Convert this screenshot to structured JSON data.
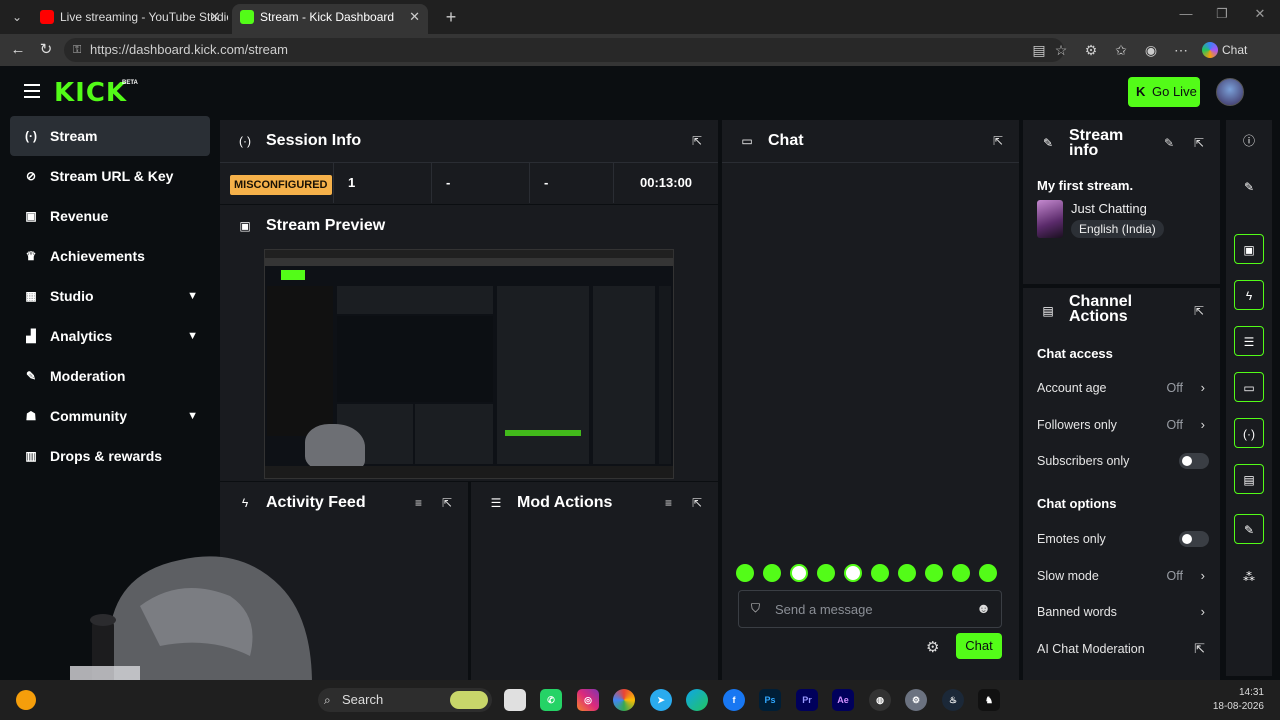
{
  "browser": {
    "tabs": [
      {
        "title": "Live streaming - YouTube Studio",
        "active": false
      },
      {
        "title": "Stream - Kick Dashboard",
        "active": true
      }
    ],
    "url": "https://dashboard.kick.com/stream",
    "copilot_label": "Chat"
  },
  "header": {
    "logo": "KICK",
    "beta": "BETA",
    "go_live": "Go Live"
  },
  "sidebar": {
    "items": [
      {
        "label": "Stream",
        "icon": "broadcast-icon",
        "active": true
      },
      {
        "label": "Stream URL & Key",
        "icon": "link-icon"
      },
      {
        "label": "Revenue",
        "icon": "revenue-icon"
      },
      {
        "label": "Achievements",
        "icon": "trophy-icon"
      },
      {
        "label": "Studio",
        "icon": "studio-icon",
        "expandable": true
      },
      {
        "label": "Analytics",
        "icon": "analytics-icon",
        "expandable": true
      },
      {
        "label": "Moderation",
        "icon": "wrench-icon"
      },
      {
        "label": "Community",
        "icon": "community-icon",
        "expandable": true
      },
      {
        "label": "Drops & rewards",
        "icon": "gift-icon"
      }
    ]
  },
  "session": {
    "title": "Session Info",
    "status": "MISCONFIGURED",
    "viewers": "1",
    "stat2": "-",
    "stat3": "-",
    "duration": "00:13:00"
  },
  "preview": {
    "title": "Stream Preview"
  },
  "activity": {
    "title": "Activity Feed"
  },
  "mod_actions": {
    "title": "Mod Actions"
  },
  "chat": {
    "title": "Chat",
    "placeholder": "Send a message",
    "send": "Chat"
  },
  "stream_info": {
    "title_line1": "Stream",
    "title_line2": "info",
    "stream_title": "My first stream.",
    "category": "Just Chatting",
    "language": "English (India)"
  },
  "channel_actions": {
    "title_line1": "Channel",
    "title_line2": "Actions",
    "chat_access": "Chat access",
    "account_age": {
      "label": "Account age",
      "value": "Off"
    },
    "followers_only": {
      "label": "Followers only",
      "value": "Off"
    },
    "subscribers_only": {
      "label": "Subscribers only"
    },
    "chat_options": "Chat options",
    "emotes_only": {
      "label": "Emotes only"
    },
    "slow_mode": {
      "label": "Slow mode",
      "value": "Off"
    },
    "banned_words": {
      "label": "Banned words"
    },
    "ai_moderation": {
      "label": "AI Chat Moderation"
    }
  },
  "taskbar": {
    "search": "Search",
    "time": "14:31",
    "date": "18-08-2026"
  },
  "colors": {
    "accent": "#53fc18",
    "warning": "#f5b14a"
  }
}
